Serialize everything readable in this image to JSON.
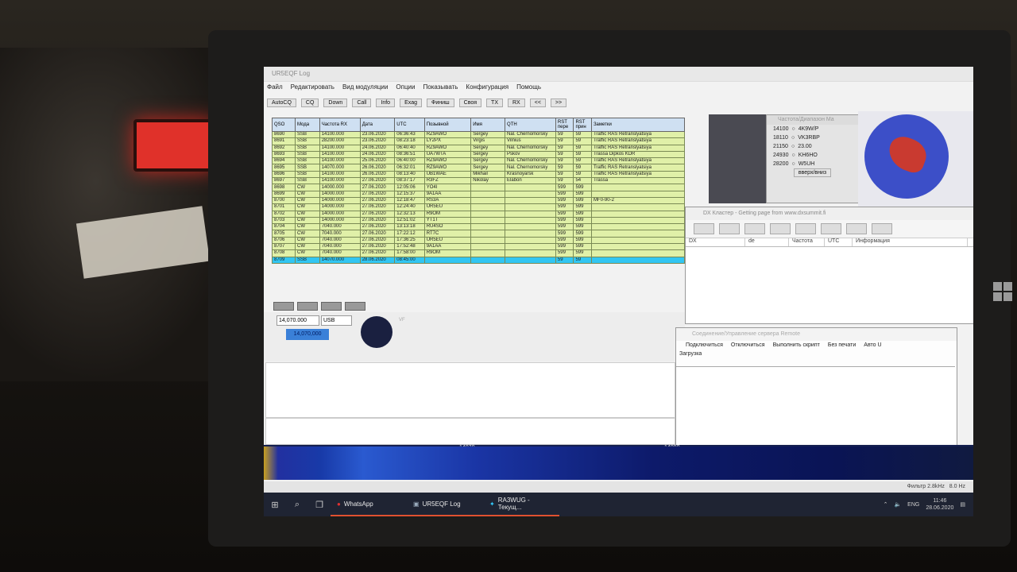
{
  "app": {
    "title": "UR5EQF Log"
  },
  "menu": [
    "Файл",
    "Редактировать",
    "Вид модуляции",
    "Опции",
    "Показывать",
    "Конфигурация",
    "Помощь"
  ],
  "toolbar": [
    "AutoCQ",
    "CQ",
    "Down",
    "Call",
    "Info",
    "Exag",
    "Финиш",
    "Своя",
    "TX",
    "RX",
    "<<",
    ">>"
  ],
  "log": {
    "headers": [
      "QSO",
      "Мода",
      "Частота RX",
      "Дата",
      "UTC",
      "Позывной",
      "Имя",
      "QTH",
      "RST пере",
      "RST прин",
      "Заметки"
    ],
    "rows": [
      [
        "8690",
        "SSB",
        "14100.000",
        "23.06.2020",
        "06:36:43",
        "RZ9AWO",
        "Sergey",
        "Nal. Chernomorsky",
        "59",
        "59",
        "Traffic RAS Retranslyatsiya"
      ],
      [
        "8691",
        "SSB",
        "28200.000",
        "23.06.2020",
        "08:23:18",
        "LY2PX",
        "Virgis",
        "Vilnius",
        "59",
        "59",
        "Traffic RAS Retranslyatsiya"
      ],
      [
        "8692",
        "SSB",
        "14100.000",
        "24.06.2020",
        "06:40:40",
        "RZ9AWO",
        "Sergey",
        "Nal. Chernomorsky",
        "59",
        "59",
        "Traffic RAS Retranslyatsiya"
      ],
      [
        "8693",
        "SSB",
        "14100.000",
        "24.06.2020",
        "08:36:51",
        "UA7WTA",
        "Sergey",
        "Pskov",
        "59",
        "59",
        "Trassa Dipkos KDR"
      ],
      [
        "8694",
        "SSB",
        "14100.000",
        "25.06.2020",
        "06:40:00",
        "RZ9AWO",
        "Sergey",
        "Nal. Chernomorsky",
        "59",
        "59",
        "Traffic RAS Retranslyatsiya"
      ],
      [
        "8695",
        "SSB",
        "14070.000",
        "26.06.2020",
        "06:32:01",
        "RZ9AWO",
        "Sergey",
        "Nal. Chernomorsky",
        "59",
        "59",
        "Traffic RAS Retranslyatsiya"
      ],
      [
        "8696",
        "SSB",
        "14100.000",
        "26.06.2020",
        "08:13:40",
        "UB1WAE",
        "Mikhail",
        "Krasnoyarsk",
        "59",
        "59",
        "Traffic RAS Retranslyatsiya"
      ],
      [
        "8697",
        "SSB",
        "14100.000",
        "27.06.2020",
        "08:37:17",
        "R3FZ",
        "Nikolay",
        "Elabon",
        "59",
        "54",
        "Trassa"
      ],
      [
        "8698",
        "CW",
        "14000.000",
        "27.06.2020",
        "12:05:06",
        "YO4I",
        "",
        "",
        "599",
        "599",
        ""
      ],
      [
        "8699",
        "CW",
        "14000.000",
        "27.06.2020",
        "12:15:37",
        "9A1AA",
        "",
        "",
        "599",
        "599",
        ""
      ],
      [
        "8700",
        "CW",
        "14000.000",
        "27.06.2020",
        "12:18:47",
        "RS3A",
        "",
        "",
        "599",
        "599",
        "MF0-90-2"
      ],
      [
        "8701",
        "CW",
        "14000.000",
        "27.06.2020",
        "12:24:40",
        "UR5EU",
        "",
        "",
        "599",
        "599",
        ""
      ],
      [
        "8702",
        "CW",
        "14000.000",
        "27.06.2020",
        "12:32:13",
        "R9OM",
        "",
        "",
        "599",
        "599",
        ""
      ],
      [
        "8703",
        "CW",
        "14000.000",
        "27.06.2020",
        "12:51:02",
        "YT1T",
        "",
        "",
        "599",
        "599",
        ""
      ],
      [
        "8704",
        "CW",
        "7040.000",
        "27.06.2020",
        "13:13:18",
        "RU4SO",
        "",
        "",
        "599",
        "599",
        ""
      ],
      [
        "8705",
        "CW",
        "7040.000",
        "27.06.2020",
        "17:22:12",
        "RT7C",
        "",
        "",
        "599",
        "599",
        ""
      ],
      [
        "8706",
        "CW",
        "7040.000",
        "27.06.2020",
        "17:36:25",
        "UR5EU",
        "",
        "",
        "599",
        "599",
        ""
      ],
      [
        "8707",
        "CW",
        "7040.000",
        "27.06.2020",
        "17:52:48",
        "9A1AA",
        "",
        "",
        "599",
        "599",
        ""
      ],
      [
        "8708",
        "CW",
        "7040.000",
        "27.06.2020",
        "17:58:00",
        "R9OM",
        "",
        "",
        "599",
        "599",
        ""
      ],
      [
        "8709",
        "SSB",
        "14070.000",
        "28.06.2020",
        "08:45:00",
        "",
        "",
        "",
        "59",
        "59",
        ""
      ]
    ]
  },
  "band_window": {
    "title": "Частота/Диапазон Ма",
    "rows": [
      {
        "freq": "14100",
        "call": "4K9W/P"
      },
      {
        "freq": "18110",
        "call": "VK3RBP"
      },
      {
        "freq": "21150",
        "call": "23.00"
      },
      {
        "freq": "24930",
        "call": "KH6HO"
      },
      {
        "freq": "28200",
        "call": "W5UH"
      }
    ],
    "button": "вверх/вниз"
  },
  "cluster": {
    "title": "DX Кластер - Getting page from www.dxsummit.fi",
    "headers": [
      "DX",
      "de",
      "Частота",
      "UTC",
      "Информация"
    ]
  },
  "radio": {
    "freq": "14,070.000",
    "mode": "USB",
    "lcd": "14,070,000",
    "vfo_label": "VF"
  },
  "remote": {
    "title": "Соединение/Управление сервера Remote",
    "menu": [
      "Подключиться",
      "Отключиться",
      "Выполнить скрипт",
      "Без печати",
      "Авто U"
    ],
    "menu2": "Загрузка"
  },
  "waterfall": {
    "marks": [
      "14070",
      "14080"
    ]
  },
  "status": {
    "text": "Фильтр 2.8kHz",
    "level": "8.0 Hz"
  },
  "taskbar": {
    "apps": [
      {
        "label": "WhatsApp"
      },
      {
        "label": "UR5EQF Log"
      },
      {
        "label": "RA3WUG - Текущ..."
      }
    ],
    "lang": "ENG",
    "time": "11:46",
    "date": "28.06.2020"
  }
}
